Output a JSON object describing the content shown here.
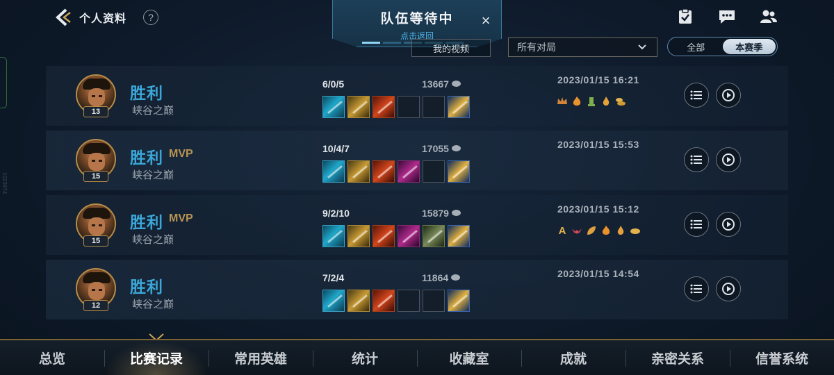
{
  "header": {
    "title": "个人资料",
    "help_label": "?"
  },
  "banner": {
    "title": "队伍等待中",
    "subtitle": "点击返回",
    "close_label": "×"
  },
  "side_text": "1023974",
  "filters": {
    "video_button": "我的视频",
    "match_type": "所有对局",
    "season_options": [
      "全部",
      "本赛季"
    ],
    "season_selected": "本赛季"
  },
  "top_icons": [
    "task-icon",
    "chat-icon",
    "friends-icon"
  ],
  "matches": [
    {
      "result": "胜利",
      "mvp": "",
      "mode": "峡谷之巅",
      "level": "13",
      "kda": "6/0/5",
      "gold": "13667",
      "date": "2023/01/15 16:21",
      "items": [
        "it-cyan",
        "it-gold",
        "it-red",
        "empty",
        "empty",
        "it-blue"
      ],
      "badges": [
        "crown-badge",
        "fire-badge",
        "tower-badge",
        "flame-badge",
        "coins-badge"
      ]
    },
    {
      "result": "胜利",
      "mvp": "MVP",
      "mode": "峡谷之巅",
      "level": "15",
      "kda": "10/4/7",
      "gold": "17055",
      "date": "2023/01/15 15:53",
      "items": [
        "it-cyan",
        "it-gold",
        "it-red",
        "it-purple",
        "empty",
        "it-blue"
      ],
      "badges": []
    },
    {
      "result": "胜利",
      "mvp": "MVP",
      "mode": "峡谷之巅",
      "level": "15",
      "kda": "9/2/10",
      "gold": "15879",
      "date": "2023/01/15 15:12",
      "items": [
        "it-cyan",
        "it-gold",
        "it-red",
        "it-purple",
        "it-green",
        "it-blue"
      ],
      "badges": [
        "letter-a-badge",
        "wings-badge",
        "leaf-badge",
        "fire-badge",
        "flame-badge",
        "coin-badge"
      ]
    },
    {
      "result": "胜利",
      "mvp": "",
      "mode": "峡谷之巅",
      "level": "12",
      "kda": "7/2/4",
      "gold": "11864",
      "date": "2023/01/15 14:54",
      "items": [
        "it-cyan",
        "it-gold",
        "it-red",
        "empty",
        "empty",
        "it-blue"
      ],
      "badges": []
    }
  ],
  "badge_a_text": "A",
  "nav": {
    "items": [
      "总览",
      "比赛记录",
      "常用英雄",
      "统计",
      "收藏室",
      "成就",
      "亲密关系",
      "信誉系统"
    ],
    "active": "比赛记录"
  },
  "colors": {
    "accent_gold": "#b58d4a",
    "victory_blue": "#3ba7d8",
    "mvp_gold": "#b89554",
    "banner_link": "#4fb4e4"
  }
}
